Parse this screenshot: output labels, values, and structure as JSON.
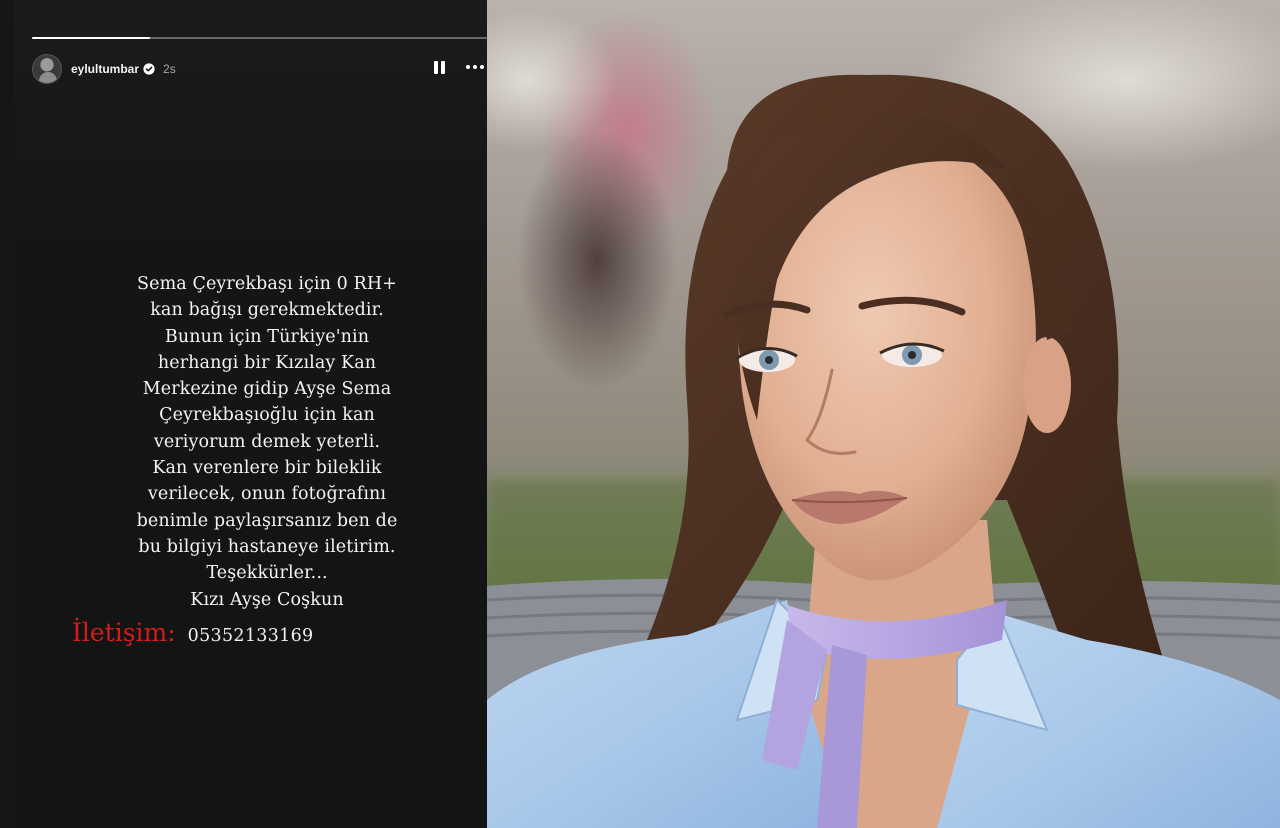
{
  "story": {
    "username": "eylultumbar",
    "time_ago": "2s",
    "progress_fraction": 0.26,
    "lines": [
      "Sema Çeyrekbaşı için 0 RH+",
      "kan bağışı gerekmektedir.",
      "Bunun için Türkiye'nin",
      "herhangi bir Kızılay Kan",
      "Merkezine gidip Ayşe Sema",
      "Çeyrekbaşıoğlu için kan",
      "veriyorum demek yeterli.",
      "Kan verenlere bir bileklik",
      "verilecek, onun fotoğrafını",
      "benimle paylaşırsanız ben de",
      "bu bilgiyi hastaneye iletirim.",
      "Teşekkürler...",
      "Kızı Ayşe Coşkun"
    ],
    "contact_label": "İletişim:",
    "contact_phone": "05352133169",
    "icons": {
      "pause": "pause-icon",
      "more": "more-options-icon",
      "verified": "verified-badge-icon"
    }
  },
  "colors": {
    "story_bg": "#141415",
    "contact_red": "#d31d1d",
    "verified_blue": "#ffffff"
  }
}
